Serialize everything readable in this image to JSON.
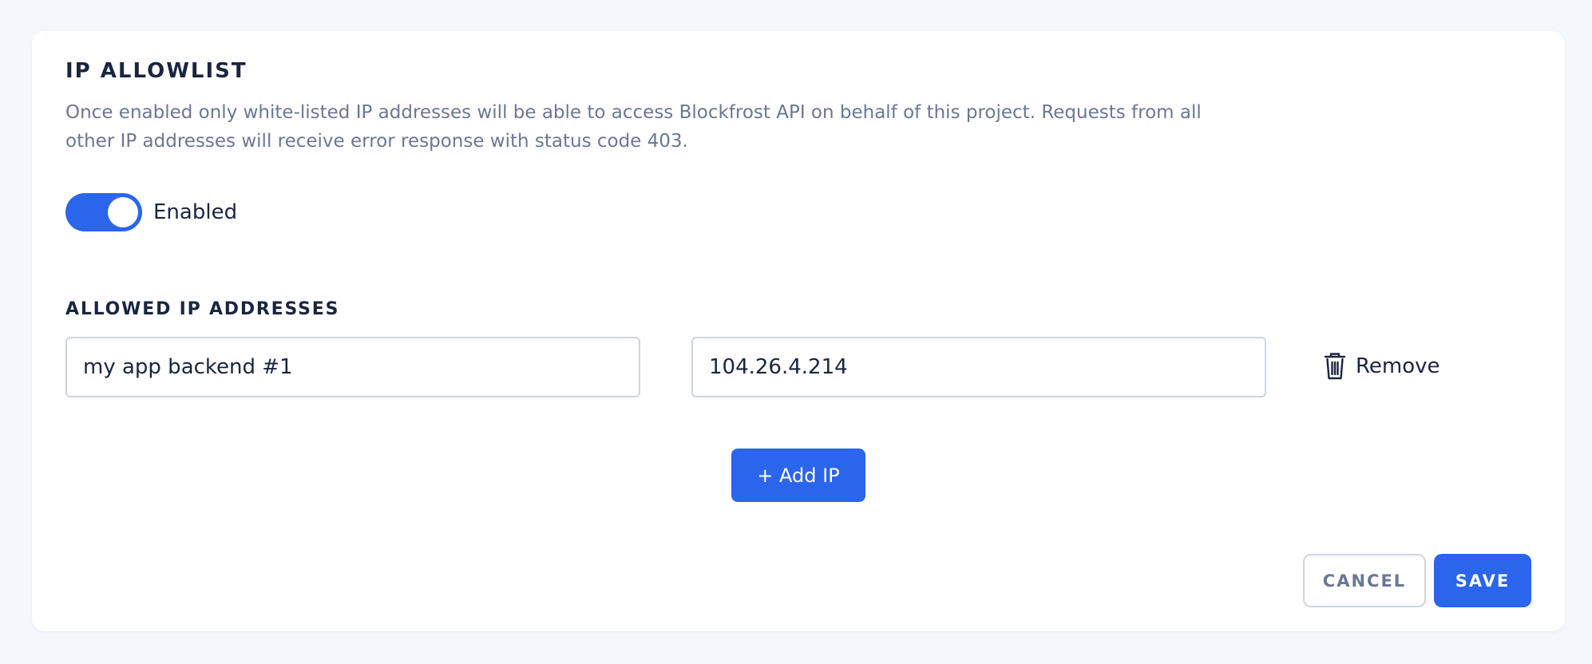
{
  "section": {
    "title": "IP ALLOWLIST",
    "description": "Once enabled only white-listed IP addresses will be able to access Blockfrost API on behalf of this project. Requests from all other IP addresses will receive error response with status code 403."
  },
  "toggle": {
    "label": "Enabled",
    "checked": true
  },
  "allowed_ips": {
    "title": "ALLOWED IP ADDRESSES",
    "entries": [
      {
        "name": "my app backend #1",
        "ip": "104.26.4.214",
        "remove_label": "Remove",
        "remove_icon": "trash-icon"
      }
    ],
    "add_label": "+ Add IP"
  },
  "actions": {
    "cancel_label": "CANCEL",
    "save_label": "SAVE"
  },
  "colors": {
    "accent": "#2b65ec",
    "background": "#f4f7fc",
    "card": "#ffffff",
    "text_primary": "#1a2540",
    "text_muted": "#6b7794",
    "border": "#cfd5e1"
  }
}
